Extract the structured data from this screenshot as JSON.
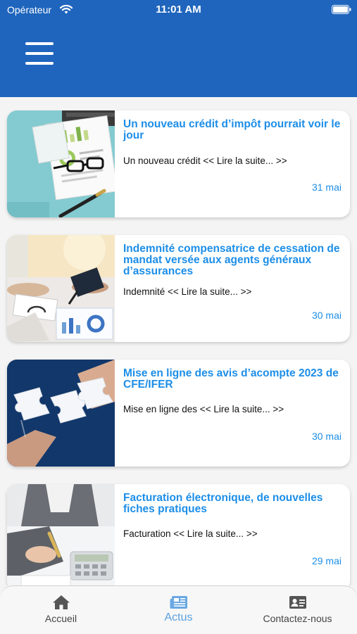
{
  "status_bar": {
    "carrier": "Opérateur",
    "time": "11:01 AM"
  },
  "header": {
    "menu_icon": "hamburger-menu-icon",
    "color": "#1f65bd"
  },
  "articles": [
    {
      "title": "Un nouveau crédit d’impôt pourrait voir le jour",
      "excerpt": "Un nouveau crédit << Lire la suite... >>",
      "date": "31 mai",
      "image": "finance-documents-glasses"
    },
    {
      "title": "Indemnité compensatrice de cessation de mandat versée aux agents généraux d’assurances",
      "excerpt": "Indemnité << Lire la suite... >>",
      "date": "30 mai",
      "image": "office-meeting-charts"
    },
    {
      "title": "Mise en ligne des avis d’acompte 2023 de CFE/IFER",
      "excerpt": "Mise en ligne des << Lire la suite... >>",
      "date": "30 mai",
      "image": "puzzle-pieces-hands"
    },
    {
      "title": "Facturation électronique, de nouvelles fiches pratiques",
      "excerpt": "Facturation << Lire la suite... >>",
      "date": "29 mai",
      "image": "business-person-pen-calculator"
    }
  ],
  "tabbar": {
    "tabs": [
      {
        "label": "Accueil",
        "icon": "home-icon",
        "active": false
      },
      {
        "label": "Actus",
        "icon": "news-icon",
        "active": true
      },
      {
        "label": "Contactez-nous",
        "icon": "contact-card-icon",
        "active": false
      }
    ]
  },
  "colors": {
    "accent": "#1c8ee8",
    "header": "#1f65bd",
    "active_tab": "#5aa0df"
  }
}
